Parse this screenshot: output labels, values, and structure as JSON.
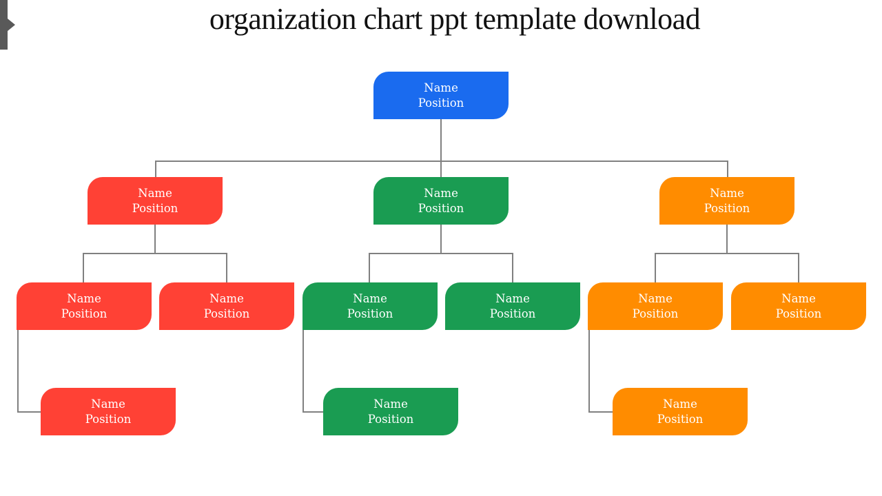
{
  "title": "organization chart ppt template download",
  "colors": {
    "top": "#1A6BEF",
    "red": "#FF4135",
    "green": "#1A9C52",
    "orange": "#FF8C00",
    "connector": "#808080"
  },
  "nodes": [
    {
      "id": "top",
      "group": "top",
      "name": "Name",
      "position": "Position"
    },
    {
      "id": "red-head",
      "group": "red",
      "name": "Name",
      "position": "Position"
    },
    {
      "id": "green-head",
      "group": "green",
      "name": "Name",
      "position": "Position"
    },
    {
      "id": "orange-head",
      "group": "orange",
      "name": "Name",
      "position": "Position"
    },
    {
      "id": "red-1",
      "group": "red",
      "name": "Name",
      "position": "Position"
    },
    {
      "id": "red-2",
      "group": "red",
      "name": "Name",
      "position": "Position"
    },
    {
      "id": "green-1",
      "group": "green",
      "name": "Name",
      "position": "Position"
    },
    {
      "id": "green-2",
      "group": "green",
      "name": "Name",
      "position": "Position"
    },
    {
      "id": "orange-1",
      "group": "orange",
      "name": "Name",
      "position": "Position"
    },
    {
      "id": "orange-2",
      "group": "orange",
      "name": "Name",
      "position": "Position"
    },
    {
      "id": "red-3",
      "group": "red",
      "name": "Name",
      "position": "Position"
    },
    {
      "id": "green-3",
      "group": "green",
      "name": "Name",
      "position": "Position"
    },
    {
      "id": "orange-3",
      "group": "orange",
      "name": "Name",
      "position": "Position"
    }
  ]
}
